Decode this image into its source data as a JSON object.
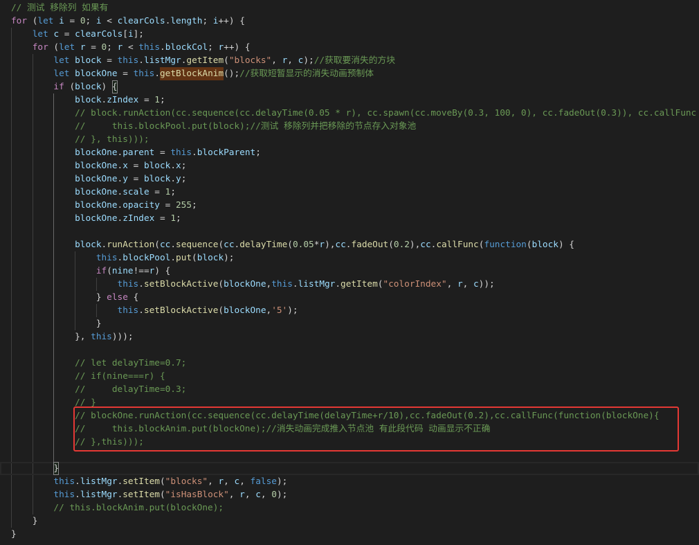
{
  "code": {
    "lines": [
      "// 测试 移除列 如果有",
      "for (let i = 0; i < clearCols.length; i++) {",
      "    let c = clearCols[i];",
      "    for (let r = 0; r < this.blockCol; r++) {",
      "        let block = this.listMgr.getItem(\"blocks\", r, c);//获取要消失的方块",
      "        let blockOne = this.getBlockAnim();//获取短暂显示的消失动画预制体",
      "        if (block) {",
      "            block.zIndex = 1;",
      "            // block.runAction(cc.sequence(cc.delayTime(0.05 * r), cc.spawn(cc.moveBy(0.3, 100, 0), cc.fadeOut(0.3)), cc.callFunc",
      "            //     this.blockPool.put(block);//测试 移除列并把移除的节点存入对象池",
      "            // }, this)));",
      "            blockOne.parent = this.blockParent;",
      "            blockOne.x = block.x;",
      "            blockOne.y = block.y;",
      "            blockOne.scale = 1;",
      "            blockOne.opacity = 255;",
      "            blockOne.zIndex = 1;",
      "",
      "            block.runAction(cc.sequence(cc.delayTime(0.05*r),cc.fadeOut(0.2),cc.callFunc(function(block) {",
      "                this.blockPool.put(block);",
      "                if(nine!==r) {",
      "                    this.setBlockActive(blockOne,this.listMgr.getItem(\"colorIndex\", r, c));",
      "                } else {",
      "                    this.setBlockActive(blockOne,'5');",
      "                }",
      "            }, this)));",
      "",
      "            // let delayTime=0.7;",
      "            // if(nine===r) {",
      "            //     delayTime=0.3;",
      "            // }",
      "            // blockOne.runAction(cc.sequence(cc.delayTime(delayTime+r/10),cc.fadeOut(0.2),cc.callFunc(function(blockOne){",
      "            //     this.blockAnim.put(blockOne);//消失动画完成推入节点池 有此段代码 动画显示不正确",
      "            // },this)));",
      "",
      "        }",
      "        this.listMgr.setItem(\"blocks\", r, c, false);",
      "        this.listMgr.setItem(\"isHasBlock\", r, c, 0);",
      "        // this.blockAnim.put(blockOne);",
      "    }",
      "}"
    ]
  },
  "syntax_colors": {
    "background": "#1e1e1e",
    "comment": "#6a9955",
    "control": "#c586c0",
    "keyword": "#569cd6",
    "function": "#dcdcaa",
    "variable": "#9cdcfe",
    "string": "#ce9178",
    "number": "#b5cea8",
    "punctuation": "#d4d4d4"
  },
  "decorations": {
    "annotation_border_color": "#e53935",
    "find_match_highlight": "#ea5c0055",
    "bracket_match_border": "#888888",
    "line_highlight_border": "#282828",
    "indent_guide": "#404040",
    "active_indent_guide": "#6a6a6a"
  }
}
